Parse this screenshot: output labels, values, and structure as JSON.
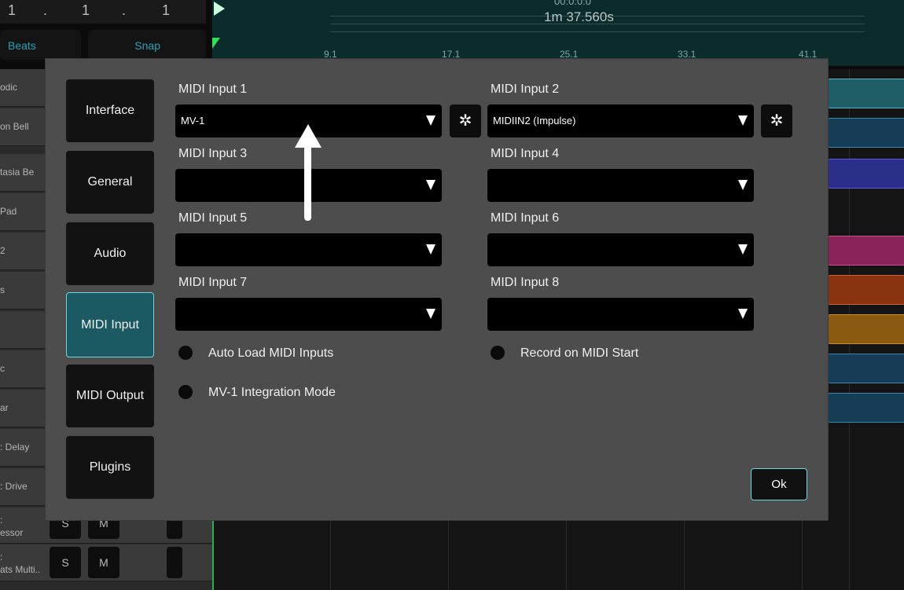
{
  "transport": {
    "position_cells": [
      "1",
      ".",
      "1",
      ".",
      "1"
    ],
    "time_top": "00:0:0:0",
    "time": "1m 37.560s",
    "beats_label": "Beats",
    "snap_label": "Snap"
  },
  "ruler": {
    "ticks": [
      "9.1",
      "17.1",
      "25.1",
      "33.1",
      "41.1"
    ]
  },
  "tracks": [
    "odic",
    "on Bell",
    "tasia Be",
    "Pad",
    "2",
    "s",
    "",
    "c",
    "ar",
    ": Delay",
    ": Drive",
    ":\nessor",
    ":\nats Multi.."
  ],
  "track_buttons": {
    "solo": "S",
    "mute": "M"
  },
  "dialog": {
    "nav": [
      {
        "label": "Interface"
      },
      {
        "label": "General"
      },
      {
        "label": "Audio"
      },
      {
        "label": "MIDI Input"
      },
      {
        "label": "MIDI Output"
      },
      {
        "label": "Plugins"
      }
    ],
    "inputs": [
      {
        "label": "MIDI Input 1",
        "value": "MV-1"
      },
      {
        "label": "MIDI Input 2",
        "value": "MIDIIN2 (Impulse)"
      },
      {
        "label": "MIDI Input 3",
        "value": ""
      },
      {
        "label": "MIDI Input 4",
        "value": ""
      },
      {
        "label": "MIDI Input 5",
        "value": ""
      },
      {
        "label": "MIDI Input 6",
        "value": ""
      },
      {
        "label": "MIDI Input 7",
        "value": ""
      },
      {
        "label": "MIDI Input 8",
        "value": ""
      }
    ],
    "options": {
      "auto_load": "Auto Load MIDI Inputs",
      "record_on_start": "Record on MIDI Start",
      "integration_mode": "MV-1 Integration Mode"
    },
    "ok_label": "Ok"
  },
  "icons": {
    "settings": "gear-icon",
    "dropdown": "triangle-down-icon",
    "annotation": "up-arrow-icon"
  },
  "colors": {
    "accent": "#6fd6e0",
    "active_nav": "#1b5a63",
    "dialog_bg": "#4d4d4d"
  }
}
